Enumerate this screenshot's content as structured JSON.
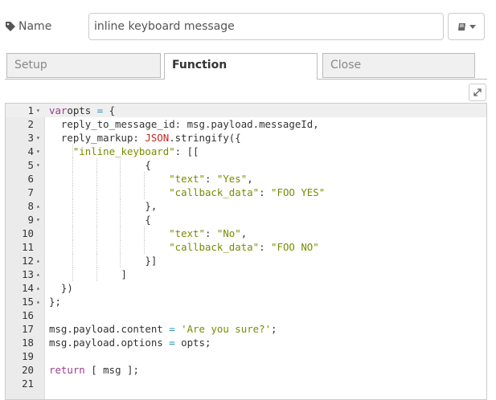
{
  "name_field": {
    "label": "Name",
    "value": "inline keyboard message"
  },
  "tabs": [
    {
      "label": "Setup",
      "active": false
    },
    {
      "label": "Function",
      "active": true
    },
    {
      "label": "Close",
      "active": false
    }
  ],
  "icons": {
    "tag": "tag-icon",
    "book": "book-icon",
    "expand": "expand-icon",
    "fold_open": "▾",
    "fold_close": "▴"
  },
  "colors": {
    "keyword": "#9b3d8f",
    "string": "#7a8b00",
    "object": "#c4271d",
    "operator": "#1f8fbf",
    "gutter": "#ebebeb"
  },
  "code": {
    "lines": [
      {
        "num": "1",
        "fold": "▾",
        "indent": 0,
        "tokens": [
          [
            "kw",
            "var"
          ],
          [
            "",
            "opts "
          ],
          [
            "op",
            "="
          ],
          [
            "",
            " {"
          ]
        ]
      },
      {
        "num": "2",
        "fold": "",
        "indent": 1,
        "tokens": [
          [
            "",
            "  reply_to_message_id: msg.payload.messageId,"
          ]
        ]
      },
      {
        "num": "3",
        "fold": "▾",
        "indent": 1,
        "tokens": [
          [
            "",
            "  reply_markup: "
          ],
          [
            "obj",
            "JSON"
          ],
          [
            "",
            ".stringify({"
          ]
        ]
      },
      {
        "num": "4",
        "fold": "▾",
        "indent": 2,
        "tokens": [
          [
            "",
            "    "
          ],
          [
            "str",
            "\"inline_keyboard\""
          ],
          [
            "",
            ": [["
          ]
        ]
      },
      {
        "num": "5",
        "fold": "▾",
        "indent": 4,
        "tokens": [
          [
            "",
            "                {"
          ]
        ]
      },
      {
        "num": "6",
        "fold": "",
        "indent": 5,
        "tokens": [
          [
            "",
            "                    "
          ],
          [
            "str",
            "\"text\""
          ],
          [
            "",
            ": "
          ],
          [
            "str",
            "\"Yes\""
          ],
          [
            "",
            ","
          ]
        ]
      },
      {
        "num": "7",
        "fold": "",
        "indent": 5,
        "tokens": [
          [
            "",
            "                    "
          ],
          [
            "str",
            "\"callback_data\""
          ],
          [
            "",
            ": "
          ],
          [
            "str",
            "\"FOO YES\""
          ]
        ]
      },
      {
        "num": "8",
        "fold": "▴",
        "indent": 4,
        "tokens": [
          [
            "",
            "                },"
          ]
        ]
      },
      {
        "num": "9",
        "fold": "▾",
        "indent": 4,
        "tokens": [
          [
            "",
            "                {"
          ]
        ]
      },
      {
        "num": "10",
        "fold": "",
        "indent": 5,
        "tokens": [
          [
            "",
            "                    "
          ],
          [
            "str",
            "\"text\""
          ],
          [
            "",
            ": "
          ],
          [
            "str",
            "\"No\""
          ],
          [
            "",
            ","
          ]
        ]
      },
      {
        "num": "11",
        "fold": "",
        "indent": 5,
        "tokens": [
          [
            "",
            "                    "
          ],
          [
            "str",
            "\"callback_data\""
          ],
          [
            "",
            ": "
          ],
          [
            "str",
            "\"FOO NO\""
          ]
        ]
      },
      {
        "num": "12",
        "fold": "▴",
        "indent": 4,
        "tokens": [
          [
            "",
            "                }]"
          ]
        ]
      },
      {
        "num": "13",
        "fold": "▴",
        "indent": 3,
        "tokens": [
          [
            "",
            "            ]"
          ]
        ]
      },
      {
        "num": "14",
        "fold": "▴",
        "indent": 1,
        "tokens": [
          [
            "",
            "  })"
          ]
        ]
      },
      {
        "num": "15",
        "fold": "▴",
        "indent": 0,
        "tokens": [
          [
            "",
            "};"
          ]
        ]
      },
      {
        "num": "16",
        "fold": "",
        "indent": 0,
        "tokens": []
      },
      {
        "num": "17",
        "fold": "",
        "indent": 0,
        "tokens": [
          [
            "",
            "msg.payload.content "
          ],
          [
            "op",
            "="
          ],
          [
            "",
            " "
          ],
          [
            "str",
            "'Are you sure?'"
          ],
          [
            "",
            ";"
          ]
        ]
      },
      {
        "num": "18",
        "fold": "",
        "indent": 0,
        "tokens": [
          [
            "",
            "msg.payload.options "
          ],
          [
            "op",
            "="
          ],
          [
            "",
            " opts;"
          ]
        ]
      },
      {
        "num": "19",
        "fold": "",
        "indent": 0,
        "tokens": []
      },
      {
        "num": "20",
        "fold": "",
        "indent": 0,
        "tokens": [
          [
            "kw",
            "return"
          ],
          [
            "",
            " [ msg ];"
          ]
        ]
      },
      {
        "num": "21",
        "fold": "",
        "indent": 0,
        "tokens": []
      }
    ]
  }
}
